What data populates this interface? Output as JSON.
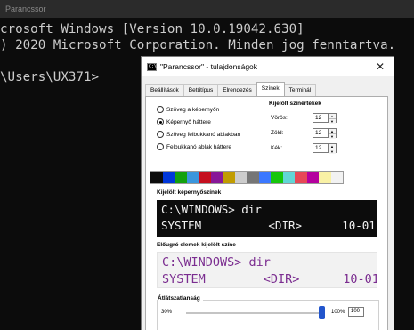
{
  "console": {
    "title": "Parancssor",
    "lines": [
      "crosoft Windows [Version 10.0.19042.630]",
      ") 2020 Microsoft Corporation. Minden jog fenntartva.",
      "",
      "\\Users\\UX371>"
    ]
  },
  "dialog": {
    "title": "\"Parancssor\" - tulajdonságok",
    "icon_text": "C:\\",
    "tabs": [
      "Beállítások",
      "Betűtípus",
      "Elrendezés",
      "Színek",
      "Terminál"
    ],
    "active_tab": "Színek",
    "radio_options": [
      {
        "label": "Szöveg a képernyőn",
        "checked": false
      },
      {
        "label": "Képernyő háttere",
        "checked": true
      },
      {
        "label": "Szöveg felbukkanó ablakban",
        "checked": false
      },
      {
        "label": "Felbukkanó ablak háttere",
        "checked": false
      }
    ],
    "selected_color": {
      "label": "Kijelölt színértékek",
      "red_label": "Vörös:",
      "red": "12",
      "green_label": "Zöld:",
      "green": "12",
      "blue_label": "Kék:",
      "blue": "12"
    },
    "palette": [
      "#0c0c0c",
      "#0037da",
      "#13a10e",
      "#3a96dd",
      "#c50f1f",
      "#881798",
      "#c19c00",
      "#cccccc",
      "#767676",
      "#3b78ff",
      "#16c60c",
      "#61d6d6",
      "#e74856",
      "#b4009e",
      "#f9f1a5",
      "#f2f2f2"
    ],
    "screen_preview": {
      "label": "Kijelölt képernyőszínek",
      "line1": "C:\\WINDOWS> dir",
      "line2": "SYSTEM          <DIR>      10-01"
    },
    "popup_preview": {
      "label": "Előugró elemek kijelölt színe",
      "line1": "C:\\WINDOWS> dir",
      "line2": "SYSTEM        <DIR>      10-01"
    },
    "opacity": {
      "label": "Átlátszatlanság",
      "min_label": "30%",
      "max_label": "100%",
      "value": "100"
    }
  }
}
